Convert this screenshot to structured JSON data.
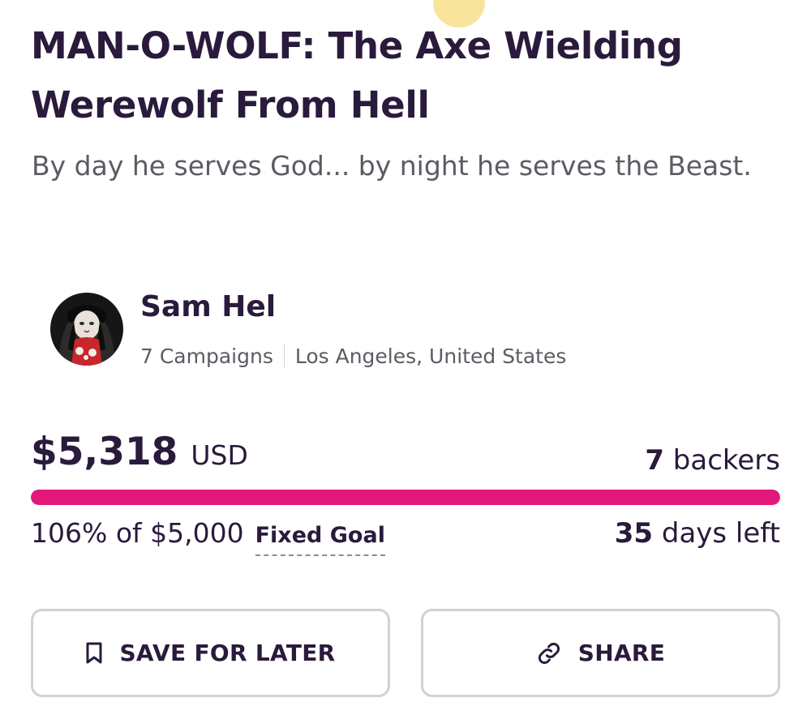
{
  "campaign": {
    "title": "MAN-O-WOLF: The Axe Wielding Werewolf From Hell",
    "tagline": "By day he serves God... by night he serves the Beast."
  },
  "creator": {
    "name": "Sam Hel",
    "campaigns": "7 Campaigns",
    "location": "Los Angeles, United States",
    "avatar_icon": "creator-avatar"
  },
  "funding": {
    "amount": "$5,318",
    "currency": "USD",
    "backers_count": "7",
    "backers_label": "backers",
    "progress_percent": 100,
    "progress_text": "106% of $5,000",
    "goal_type": "Fixed Goal",
    "days_count": "35",
    "days_label": "days left",
    "accent_color": "#e2197a"
  },
  "actions": {
    "save_label": "SAVE FOR LATER",
    "save_icon": "bookmark-icon",
    "share_label": "SHARE",
    "share_icon": "link-icon"
  }
}
